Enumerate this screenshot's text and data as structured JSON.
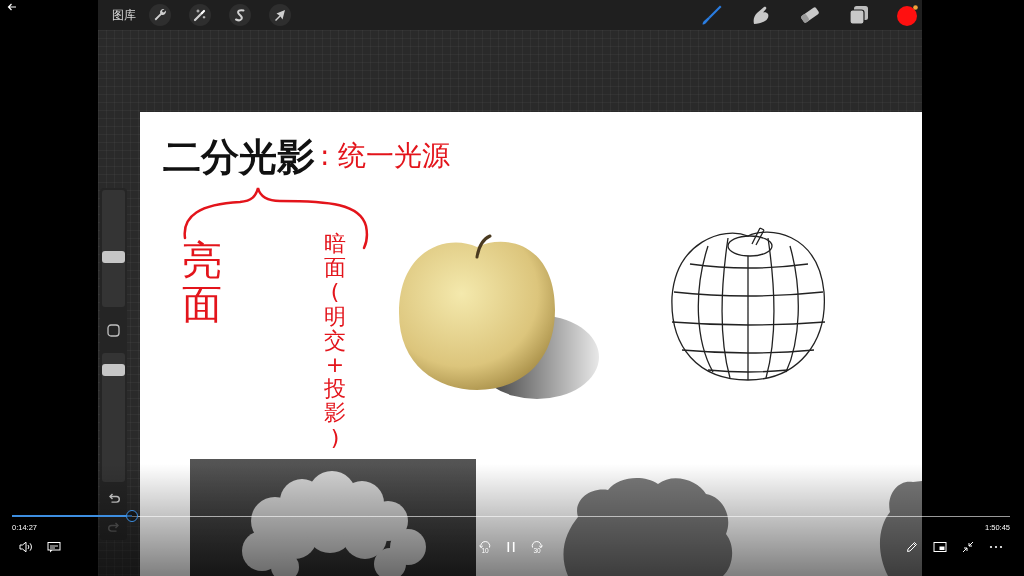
{
  "app_toolbar": {
    "gallery_label": "图库",
    "left_tools": [
      {
        "kind": "wrench"
      },
      {
        "kind": "wand"
      },
      {
        "kind": "selection"
      },
      {
        "kind": "transform"
      }
    ],
    "right_tools": [
      {
        "kind": "brush",
        "selected": true
      },
      {
        "kind": "smudge",
        "selected": false
      },
      {
        "kind": "eraser",
        "selected": false
      }
    ]
  },
  "sidebar": {
    "sliders": [
      {
        "level": 0.42
      },
      {
        "level": 0.91
      }
    ],
    "history": [
      {
        "kind": "undo",
        "disabled": false
      },
      {
        "kind": "redo",
        "disabled": true
      }
    ]
  },
  "canvas": {
    "title": "二分光影",
    "note": ": 统一光源",
    "labels": [
      {
        "text": "亮面"
      },
      {
        "text": "暗面(明交+投影)"
      }
    ]
  },
  "player": {
    "level": 0.12,
    "elapsed": "0:14:27",
    "duration": "1:50:45",
    "playing": true,
    "rewind_label": "10",
    "forward_label": "30"
  }
}
